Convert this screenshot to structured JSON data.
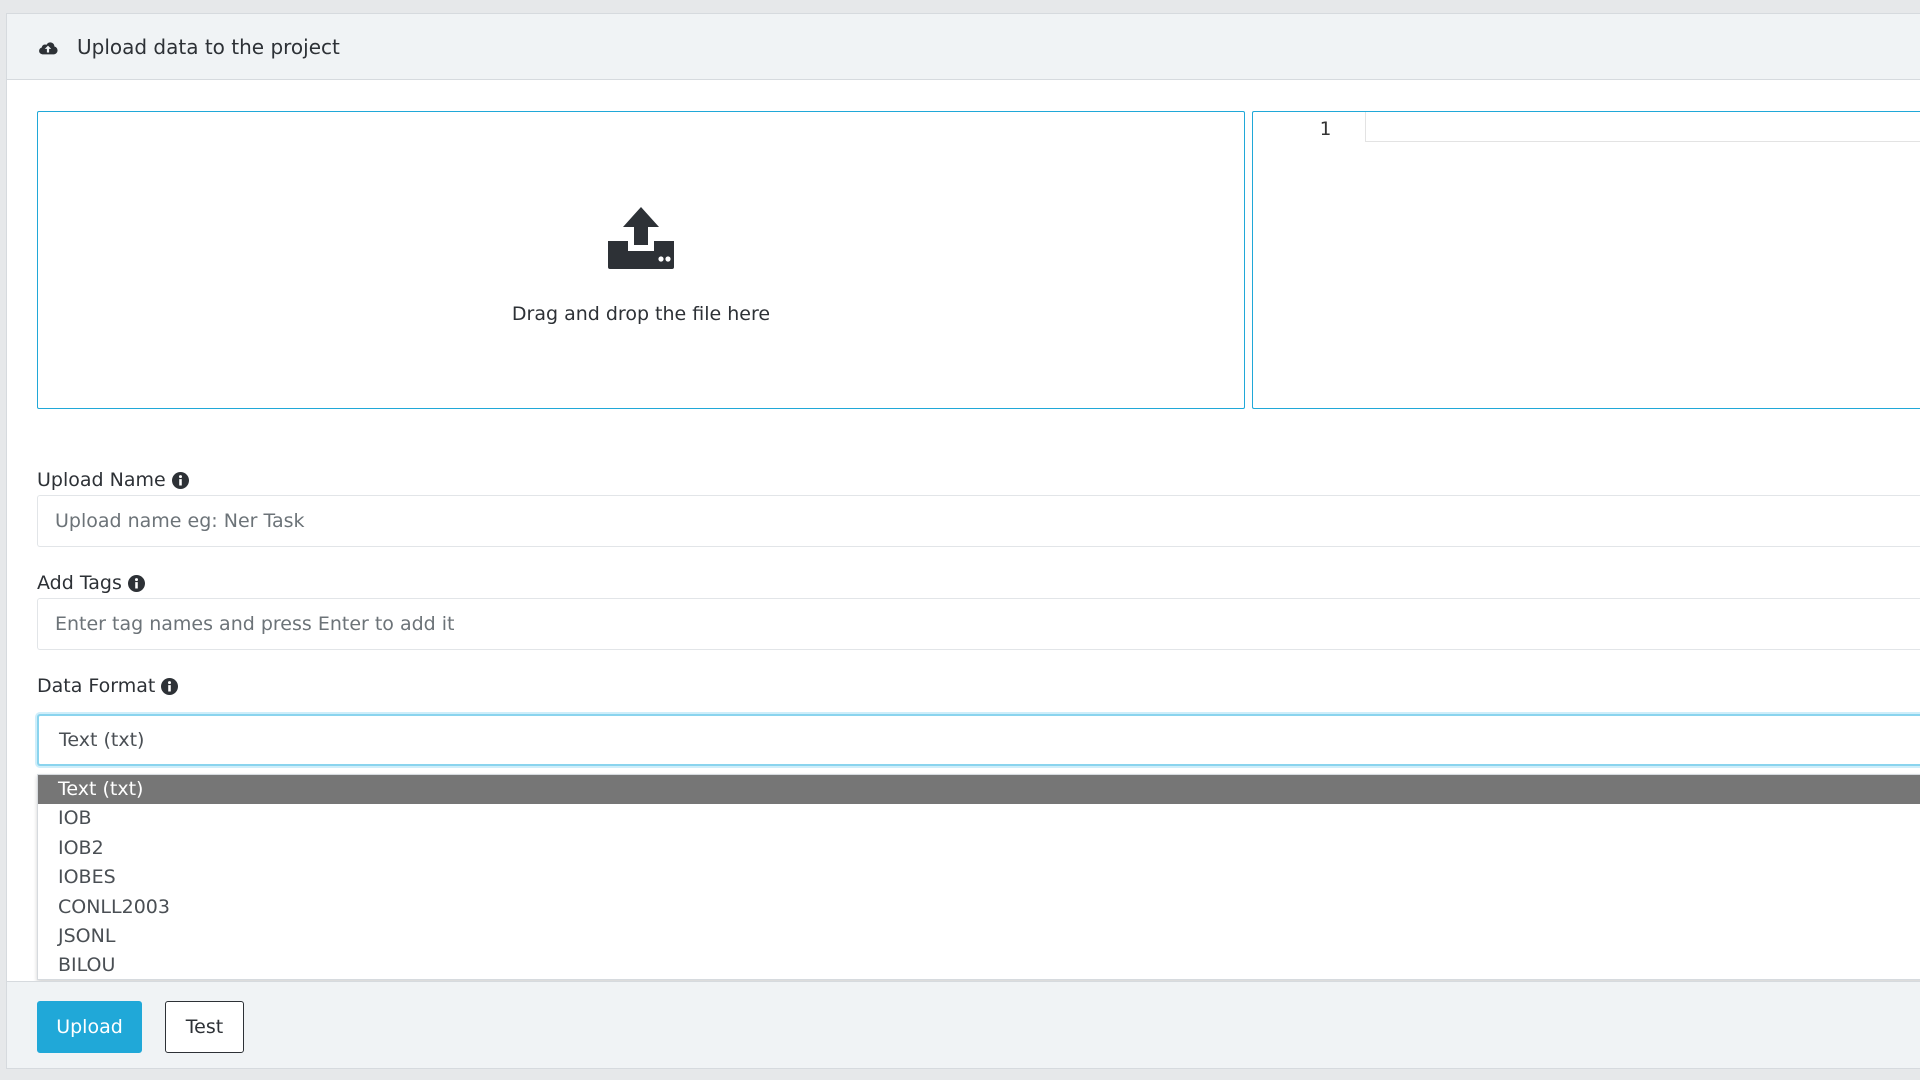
{
  "header": {
    "title": "Upload data to the project",
    "icon": "cloud-upload-icon"
  },
  "dropzone": {
    "text": "Drag and drop the file here",
    "icon": "upload-icon"
  },
  "editor": {
    "line_numbers": [
      "1"
    ]
  },
  "fields": {
    "upload_name": {
      "label": "Upload Name",
      "placeholder": "Upload name eg: Ner Task"
    },
    "tags": {
      "label": "Add Tags",
      "placeholder": "Enter tag names and press Enter to add it"
    },
    "data_format": {
      "label": "Data Format",
      "selected": "Text (txt)"
    }
  },
  "dropdown": {
    "options": [
      {
        "label": "Text (txt)",
        "selected": true
      },
      {
        "label": "IOB"
      },
      {
        "label": "IOB2"
      },
      {
        "label": "IOBES"
      },
      {
        "label": "CONLL2003"
      },
      {
        "label": "JSONL"
      },
      {
        "label": "BILOU"
      }
    ]
  },
  "footer": {
    "upload_label": "Upload",
    "test_label": "Test"
  },
  "colors": {
    "accent": "#20a8d8",
    "selected_option": "#767676"
  }
}
